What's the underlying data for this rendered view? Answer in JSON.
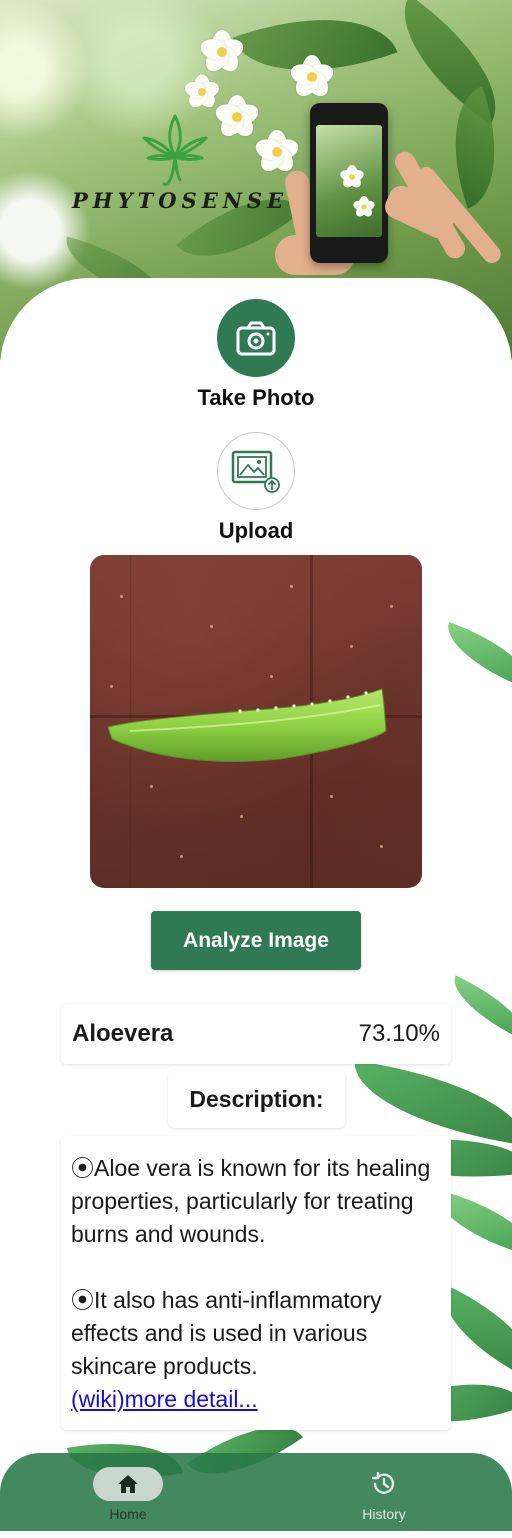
{
  "app": {
    "brand_name": "PHYTOSENSE"
  },
  "actions": {
    "take_photo_label": "Take Photo",
    "upload_label": "Upload"
  },
  "analyze": {
    "button_label": "Analyze Image"
  },
  "result": {
    "plant_name": "Aloevera",
    "confidence": "73.10%"
  },
  "description": {
    "title": "Description:",
    "paragraphs": [
      "⦿Aloe vera is known for its healing properties, particularly for treating burns and wounds.",
      "⦿It also has anti-inflammatory effects and is used in various skincare products."
    ],
    "link_text": "(wiki)more detail..."
  },
  "nav": {
    "items": [
      {
        "label": "Home",
        "icon": "home-icon",
        "active": true
      },
      {
        "label": "History",
        "icon": "history-icon",
        "active": false
      }
    ]
  },
  "colors": {
    "primary_green": "#2f7a52",
    "nav_bg": "#297848",
    "link": "#1a0dcc"
  }
}
